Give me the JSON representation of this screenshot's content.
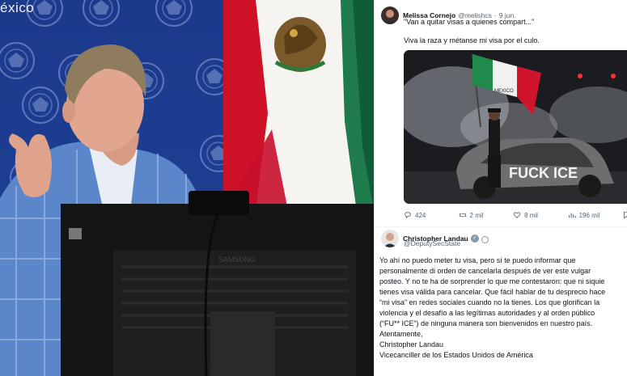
{
  "photo": {
    "banner_text": "éxico",
    "monitor_brand": "SAMSUNG",
    "flag_emblem_alt": "mexican-flag-coat-of-arms"
  },
  "tweet1": {
    "display_name": "Melissa Cornejo",
    "handle": "@melishcs",
    "separator": "·",
    "date": "9 jun.",
    "quote": "\"Van a quitar visas a quienes compart...\"",
    "body": "Viva la raza y métanse mi visa por el culo.",
    "media": {
      "car_graffiti": "FUCK ICE",
      "flag_text": "MEXICO"
    },
    "actions": {
      "replies": "424",
      "reposts": "2 mil",
      "likes": "8 mil",
      "views": "196 mil"
    }
  },
  "tweet2": {
    "display_name": "Christopher Landau",
    "handle": "@DeputySecState",
    "lines": [
      "Yo ahí no puedo meter tu visa, pero sí te puedo informar que",
      "personalmente di orden de cancelarla después de ver este vulgar",
      "posteo. Y no te ha de sorprender lo que me contestaron: que ni siquie",
      "tienes visa válida para cancelar. Que fácil hablar de tu desprecio hace",
      "“mi visa” en redes sociales cuando no la tienes. Los que glorifican la",
      "violencia y el desafío a las legítimas autoridades y al orden público",
      "(“FU** ICE”) de ninguna manera son bienvenidos en nuestro país.",
      "Atentamente,",
      "Christopher Landau",
      "Vicecanciller de los Estados Unidos de América"
    ]
  },
  "colors": {
    "name": "#0f1419",
    "meta": "#536471",
    "wall_blue": "#1d3e92",
    "flag_green": "#006847",
    "flag_red": "#ce1126"
  }
}
